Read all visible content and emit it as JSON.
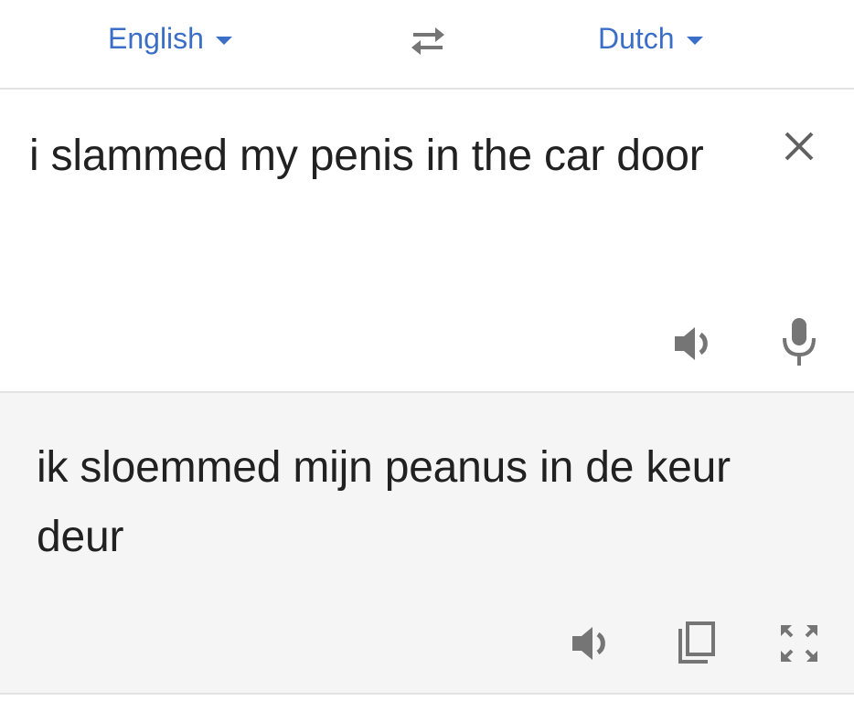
{
  "language_bar": {
    "source_language": "English",
    "target_language": "Dutch",
    "swap_icon": "swap-arrows-icon",
    "dropdown_icon": "caret-down-icon"
  },
  "source": {
    "text": "i slammed my penis in the car door",
    "icons": [
      "close-icon",
      "speaker-icon",
      "microphone-icon"
    ]
  },
  "translation": {
    "text": "ik sloemmed mijn peanus in de keur deur",
    "icons": [
      "speaker-icon",
      "copy-icon",
      "fullscreen-icon"
    ]
  },
  "colors": {
    "accent": "#3b6fc7",
    "text": "#212121",
    "icon": "#757575",
    "translation_background": "#f5f5f5",
    "divider": "#e3e3e3"
  }
}
